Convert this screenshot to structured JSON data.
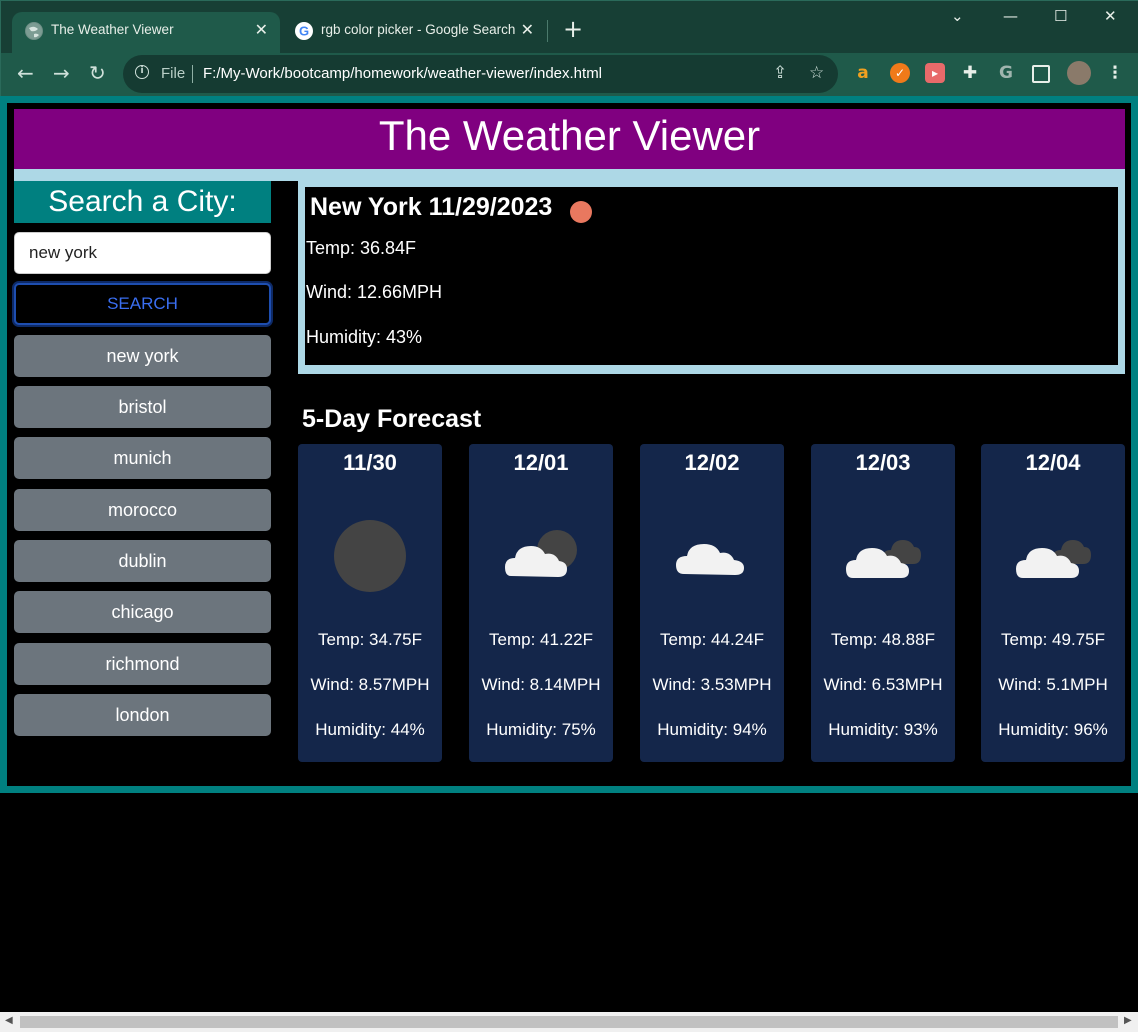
{
  "browser": {
    "tabs": [
      {
        "title": "The Weather Viewer",
        "active": true
      },
      {
        "title": "rgb color picker - Google Search",
        "active": false
      }
    ],
    "new_tab_label": "+",
    "window_controls": {
      "dropdown": "⌄",
      "minimize": "—",
      "maximize": "☐",
      "close": "✕"
    },
    "address": {
      "scheme": "File",
      "url": "F:/My-Work/bootcamp/homework/weather-viewer/index.html"
    }
  },
  "page": {
    "title": "The Weather Viewer",
    "sidebar": {
      "heading": "Search a City:",
      "search_value": "new york",
      "search_button": "SEARCH",
      "history": [
        "new york",
        "bristol",
        "munich",
        "morocco",
        "dublin",
        "chicago",
        "richmond",
        "london"
      ]
    },
    "current": {
      "city_date": "New York 11/29/2023",
      "icon": "sun-icon",
      "temp": "Temp: 36.84F",
      "wind": "Wind: 12.66MPH",
      "humidity": "Humidity: 43%"
    },
    "forecast_heading": "5-Day Forecast",
    "forecast": [
      {
        "date": "11/30",
        "icon": "moon-icon",
        "temp": "Temp: 34.75F",
        "wind": "Wind: 8.57MPH",
        "humidity": "Humidity: 44%"
      },
      {
        "date": "12/01",
        "icon": "cloud-moon-icon",
        "temp": "Temp: 41.22F",
        "wind": "Wind: 8.14MPH",
        "humidity": "Humidity: 75%"
      },
      {
        "date": "12/02",
        "icon": "cloud-icon",
        "temp": "Temp: 44.24F",
        "wind": "Wind: 3.53MPH",
        "humidity": "Humidity: 94%"
      },
      {
        "date": "12/03",
        "icon": "clouds-icon",
        "temp": "Temp: 48.88F",
        "wind": "Wind: 6.53MPH",
        "humidity": "Humidity: 93%"
      },
      {
        "date": "12/04",
        "icon": "clouds-icon",
        "temp": "Temp: 49.75F",
        "wind": "Wind: 5.1MPH",
        "humidity": "Humidity: 96%"
      }
    ]
  },
  "colors": {
    "header": "#800080",
    "accent_teal": "#008080",
    "light_blue": "#add8e6",
    "history_button": "#6c757d",
    "forecast_card": "#14264a",
    "current_icon": "#e9785f"
  }
}
